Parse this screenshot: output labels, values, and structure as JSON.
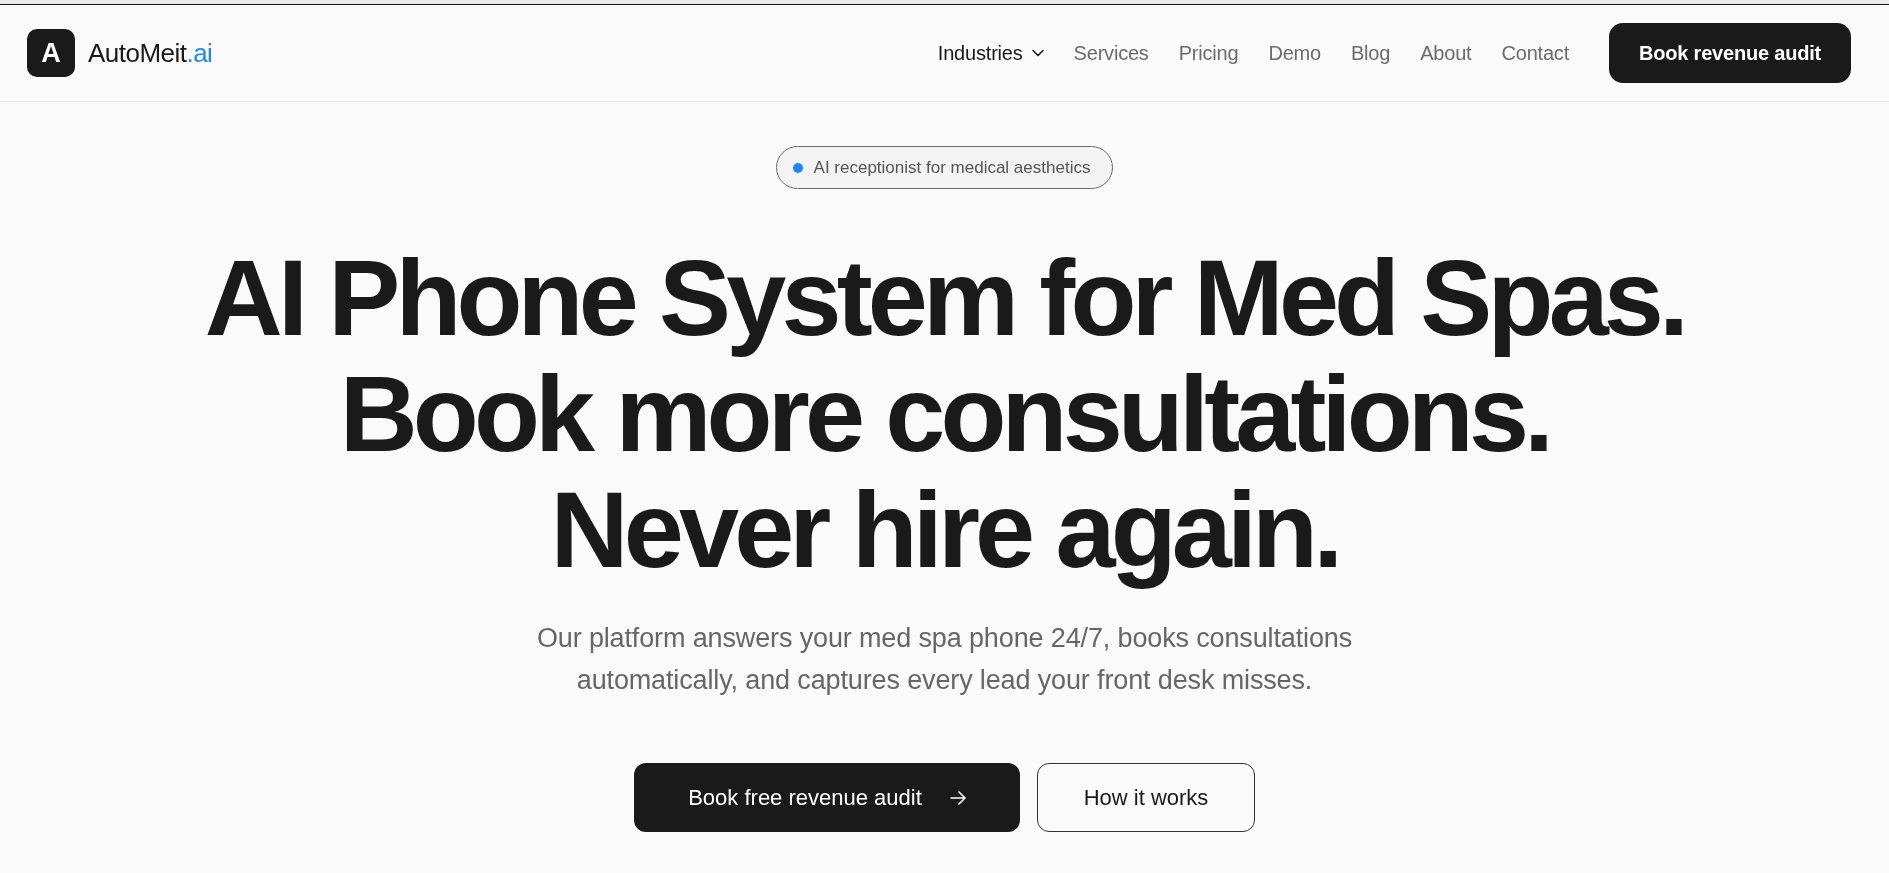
{
  "brand": {
    "logo_letter": "A",
    "name": "AutoMeit",
    "suffix": ".ai"
  },
  "nav": {
    "items": [
      {
        "label": "Industries",
        "kind": "dropdown"
      },
      {
        "label": "Services",
        "kind": "link"
      },
      {
        "label": "Pricing",
        "kind": "link"
      },
      {
        "label": "Demo",
        "kind": "link"
      },
      {
        "label": "Blog",
        "kind": "link"
      },
      {
        "label": "About",
        "kind": "link"
      },
      {
        "label": "Contact",
        "kind": "link"
      }
    ],
    "cta": "Book revenue audit"
  },
  "hero": {
    "badge": "AI receptionist for medical aesthetics",
    "headline": [
      "AI Phone System for Med Spas.",
      "Book more consultations.",
      "Never hire again."
    ],
    "subtitle": [
      "Our platform answers your med spa phone 24/7, books consultations",
      "automatically, and captures every lead your front desk misses."
    ],
    "buttons": [
      {
        "label": "Book free revenue audit",
        "kind": "primary"
      },
      {
        "label": "How it works",
        "kind": "secondary"
      }
    ]
  }
}
